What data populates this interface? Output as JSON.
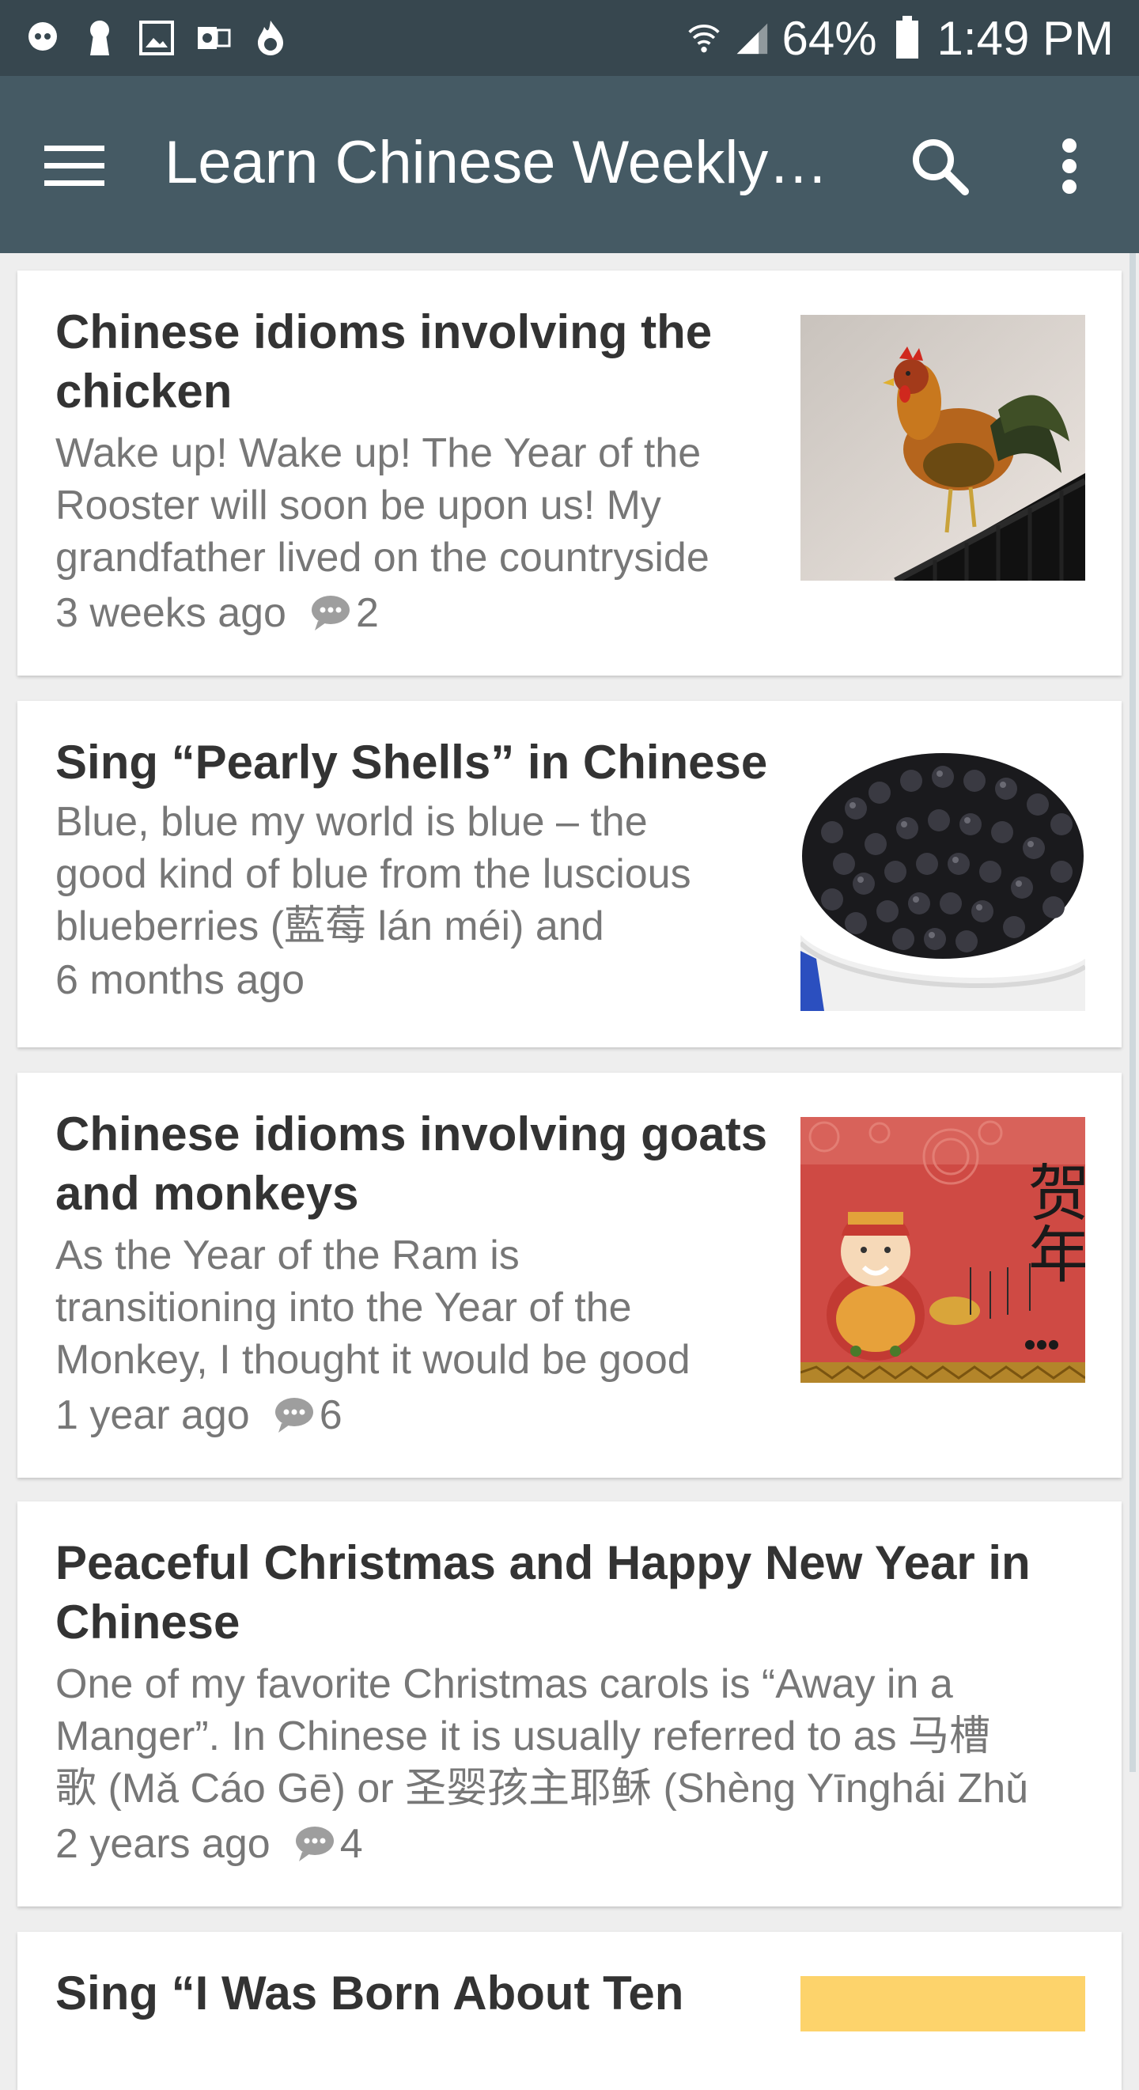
{
  "status_bar": {
    "battery": "64%",
    "time": "1:49 PM",
    "icons": [
      "chat-icon",
      "keyhole-icon",
      "image-icon",
      "outlook-icon",
      "fire-icon",
      "wifi-icon",
      "signal-icon",
      "battery-icon"
    ]
  },
  "app_bar": {
    "title": "Learn Chinese Weekly…",
    "icons": [
      "menu-icon",
      "search-icon",
      "more-vert-icon"
    ]
  },
  "posts": [
    {
      "title_line1": "Chinese idioms involving the",
      "title_line2": "chicken",
      "excerpt_line1": "Wake up! Wake up! The Year of the",
      "excerpt_line2": "Rooster will soon be upon us! My",
      "excerpt_line3": "grandfather lived on the countryside",
      "age": "3 weeks ago",
      "comments": "2"
    },
    {
      "title_line1": "Sing “Pearly Shells” in Chinese",
      "excerpt_line1": "Blue, blue my world is blue – the",
      "excerpt_line2": "good kind of blue from the luscious",
      "excerpt_line3": "blueberries (藍莓 lán méi) and",
      "age": "6 months ago"
    },
    {
      "title_line1": "Chinese idioms involving goats",
      "title_line2": "and monkeys",
      "excerpt_line1": "As the Year of the Ram is",
      "excerpt_line2": "transitioning into the Year of the",
      "excerpt_line3": "Monkey, I thought it would be good",
      "age": "1 year ago",
      "comments": "6",
      "image_text": "贺年"
    },
    {
      "title_line1": "Peaceful Christmas and Happy New Year in",
      "title_line2": "Chinese",
      "excerpt_line1": "One of my favorite Christmas carols is “Away in a",
      "excerpt_line2": "Manger”. In Chinese it is usually referred to as 马槽",
      "excerpt_line3": "歌 (Mǎ Cáo Gē) or 圣婴孩主耶稣 (Shèng Yīnghái Zhǔ",
      "age": "2 years ago",
      "comments": "4"
    },
    {
      "title_line1": "Sing “I Was Born About Ten"
    }
  ],
  "colors": {
    "status_bar": "#37474f",
    "app_bar": "#455a64",
    "background": "#eeeeee",
    "title_text": "#333333",
    "secondary_text": "#777777"
  }
}
